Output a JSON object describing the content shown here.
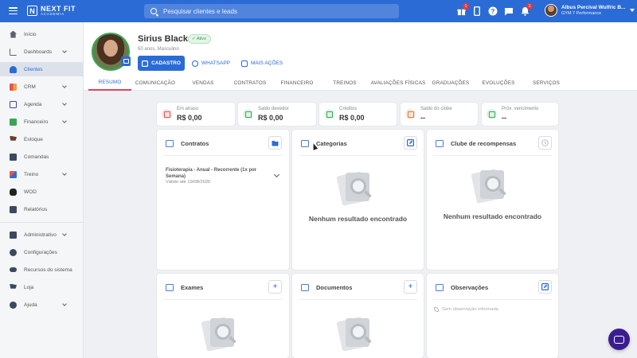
{
  "app": {
    "logo_line1": "NEXT FIT",
    "logo_line2": "ACADEMIA",
    "search_placeholder": "Pesquisar clientes e leads",
    "badges": {
      "gift": "1",
      "bell": "1"
    },
    "user_name": "Albus Percival Wulfric B...",
    "user_gym": "GYM 7 Performance",
    "brand_color": "#2b6bd6"
  },
  "sidebar": {
    "items": [
      {
        "label": "Início",
        "icon": "home-icon"
      },
      {
        "label": "Dashboards",
        "icon": "chart-icon"
      },
      {
        "label": "Clientes",
        "icon": "users-icon"
      },
      {
        "label": "CRM",
        "icon": "crm-icon"
      },
      {
        "label": "Agenda",
        "icon": "calendar-icon"
      },
      {
        "label": "Financeiro",
        "icon": "money-icon"
      },
      {
        "label": "Estoque",
        "icon": "cart-icon"
      },
      {
        "label": "Comandas",
        "icon": "receipt-icon"
      },
      {
        "label": "Treino",
        "icon": "dumbbell-icon"
      },
      {
        "label": "WOD",
        "icon": "kettlebell-icon"
      },
      {
        "label": "Relatórios",
        "icon": "report-icon"
      },
      {
        "label": "Administrativo",
        "icon": "admin-icon"
      },
      {
        "label": "Configurações",
        "icon": "gear-icon"
      },
      {
        "label": "Recursos do sistema",
        "icon": "toggle-icon"
      },
      {
        "label": "Loja",
        "icon": "shop-icon"
      },
      {
        "label": "Ajuda",
        "icon": "help-icon"
      }
    ]
  },
  "profile": {
    "name": "Sirius Black",
    "status": "Ativo",
    "meta": "50 anos, Masculino",
    "btn_cadastro": "CADASTRO",
    "btn_whatsapp": "WHATSAPP",
    "btn_mais": "MAIS AÇÕES"
  },
  "tabs": [
    "RESUMO",
    "COMUNICAÇÃO",
    "VENDAS",
    "CONTRATOS",
    "FINANCEIRO",
    "TREINOS",
    "AVALIAÇÕES FÍSICAS",
    "GRADUAÇÕES",
    "EVOLUÇÕES",
    "SERVIÇOS"
  ],
  "summary": [
    {
      "title": "Em atraso",
      "value": "R$ 0,00",
      "color": "#e05555"
    },
    {
      "title": "Saldo devedor",
      "value": "R$ 0,00",
      "color": "#3aa655"
    },
    {
      "title": "Créditos",
      "value": "R$ 0,00",
      "color": "#3aa655"
    },
    {
      "title": "Saldo do clube",
      "value": "--",
      "color": "#e07a3a"
    },
    {
      "title": "Próx. vencimento",
      "value": "--",
      "color": "#3aa655"
    }
  ],
  "panels": {
    "contratos": {
      "title": "Contratos",
      "item_title": "Fisioterapia - Anual - Recorrente (1x por Semana)",
      "item_sub": "Válido até 19/08/2026"
    },
    "categorias": {
      "title": "Categorias",
      "empty": "Nenhum resultado encontrado"
    },
    "clube": {
      "title": "Clube de recompensas",
      "empty": "Nenhum resultado encontrado"
    },
    "exames": {
      "title": "Exames"
    },
    "documentos": {
      "title": "Documentos"
    },
    "observacoes": {
      "title": "Observações",
      "empty": "Sem observação informada"
    }
  }
}
